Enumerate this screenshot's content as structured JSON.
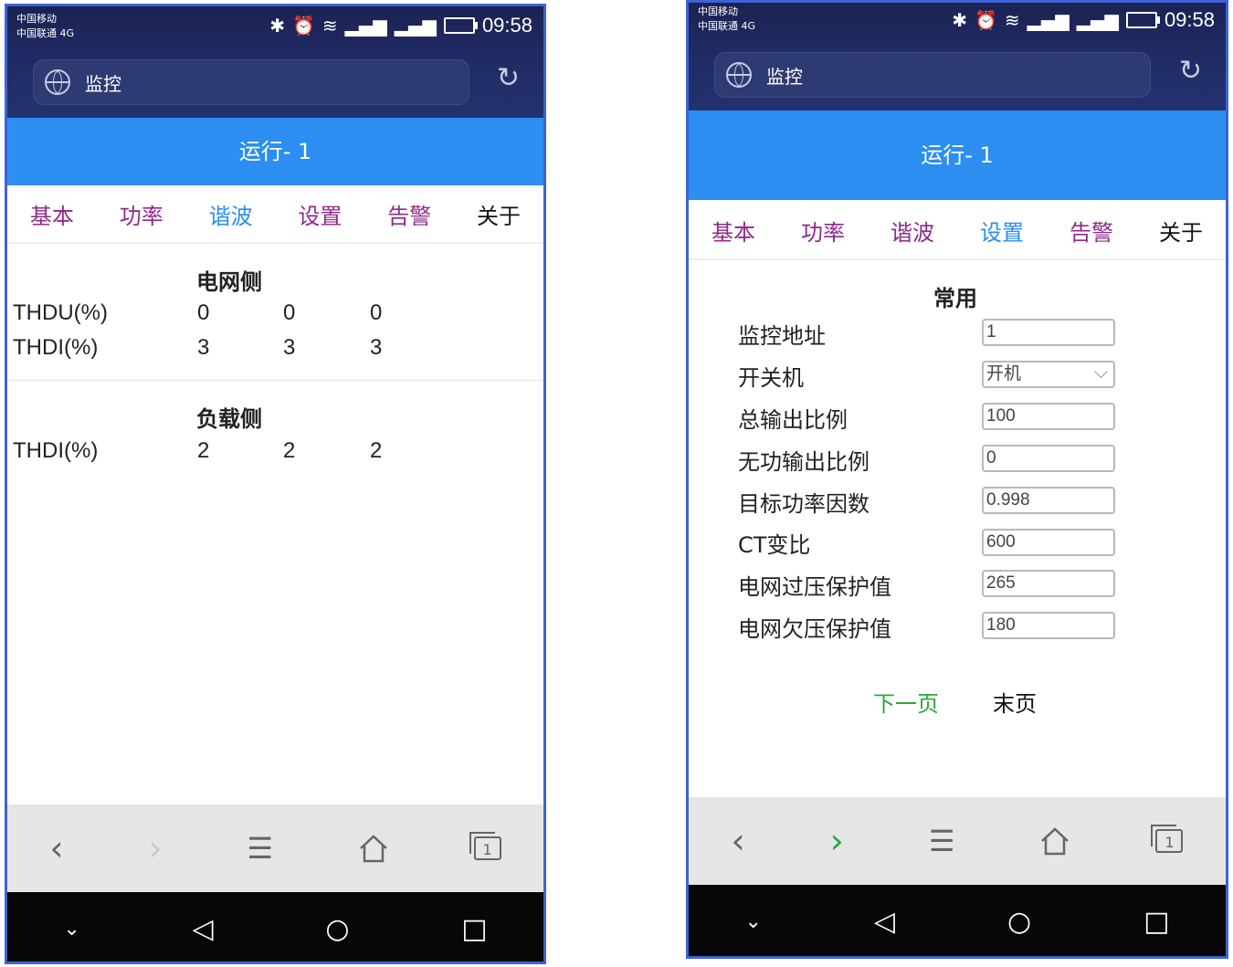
{
  "status_bar": {
    "carrier1": "中国移动",
    "carrier2": "中国联通 4G",
    "time": "09:58"
  },
  "browser": {
    "url_title": "监控"
  },
  "page_title": "运行- 1",
  "tabs": [
    "基本",
    "功率",
    "谐波",
    "设置",
    "告警",
    "关于"
  ],
  "harmonics_screen": {
    "active_tab": "谐波",
    "grid_side": {
      "title": "电网侧",
      "rows": [
        {
          "label": "THDU(%)",
          "values": [
            "0",
            "0",
            "0"
          ]
        },
        {
          "label": "THDI(%)",
          "values": [
            "3",
            "3",
            "3"
          ]
        }
      ]
    },
    "load_side": {
      "title": "负载侧",
      "rows": [
        {
          "label": "THDI(%)",
          "values": [
            "2",
            "2",
            "2"
          ]
        }
      ]
    }
  },
  "settings_screen": {
    "active_tab": "设置",
    "section_title": "常用",
    "fields": [
      {
        "label": "监控地址",
        "value": "1",
        "type": "text"
      },
      {
        "label": "开关机",
        "value": "开机",
        "type": "select"
      },
      {
        "label": "总输出比例",
        "value": "100",
        "type": "text"
      },
      {
        "label": "无功输出比例",
        "value": "0",
        "type": "text"
      },
      {
        "label": "目标功率因数",
        "value": "0.998",
        "type": "text"
      },
      {
        "label": "CT变比",
        "value": "600",
        "type": "text"
      },
      {
        "label": "电网过压保护值",
        "value": "265",
        "type": "text"
      },
      {
        "label": "电网欠压保护值",
        "value": "180",
        "type": "text"
      }
    ],
    "next_page": "下一页",
    "last_page": "末页"
  },
  "colors": {
    "accent_blue": "#2b8ef0",
    "tab_purple": "#8e2a8a",
    "header_navy": "#1f2a62",
    "next_green": "#2aa834"
  }
}
